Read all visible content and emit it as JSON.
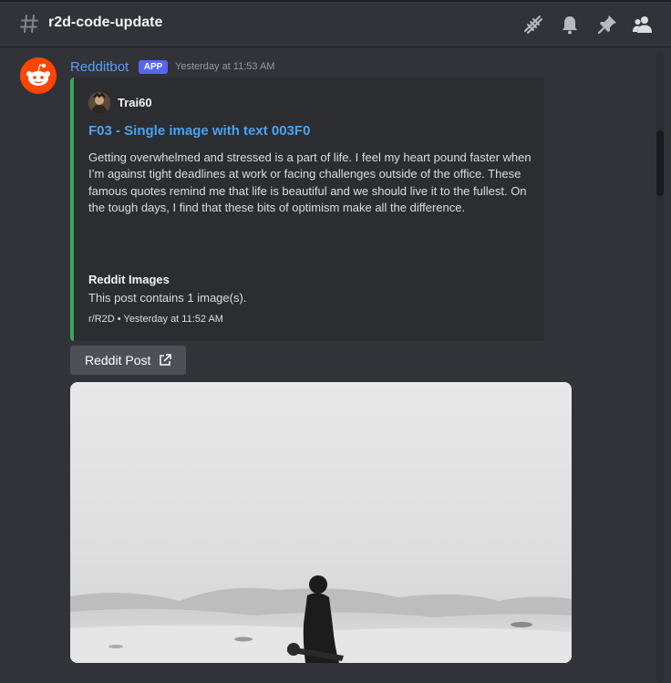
{
  "header": {
    "channel_name": "r2d-code-update",
    "icons": [
      "threads-icon",
      "bell-icon",
      "pin-icon",
      "members-icon"
    ]
  },
  "message": {
    "username": "Redditbot",
    "badge": "APP",
    "timestamp": "Yesterday at 11:53 AM",
    "embed": {
      "accent_color": "#3ba55c",
      "author": "Trai60",
      "title": "F03 - Single image with text 003F0",
      "description": "Getting overwhelmed and stressed is a part of life. I feel my heart pound faster when I’m against tight deadlines at work or facing challenges outside of the office. These famous quotes remind me that life is beautiful and we should live it to the fullest. On the tough days, I find that these bits of optimism make all the difference.",
      "field_name": "Reddit Images",
      "field_value": "This post contains 1 image(s).",
      "footer": "r/R2D • Yesterday at 11:52 AM"
    },
    "button_label": "Reddit Post"
  },
  "colors": {
    "background": "#313338",
    "link": "#4aa3ef",
    "username": "#5b9ef3",
    "badge": "#5865f2"
  }
}
